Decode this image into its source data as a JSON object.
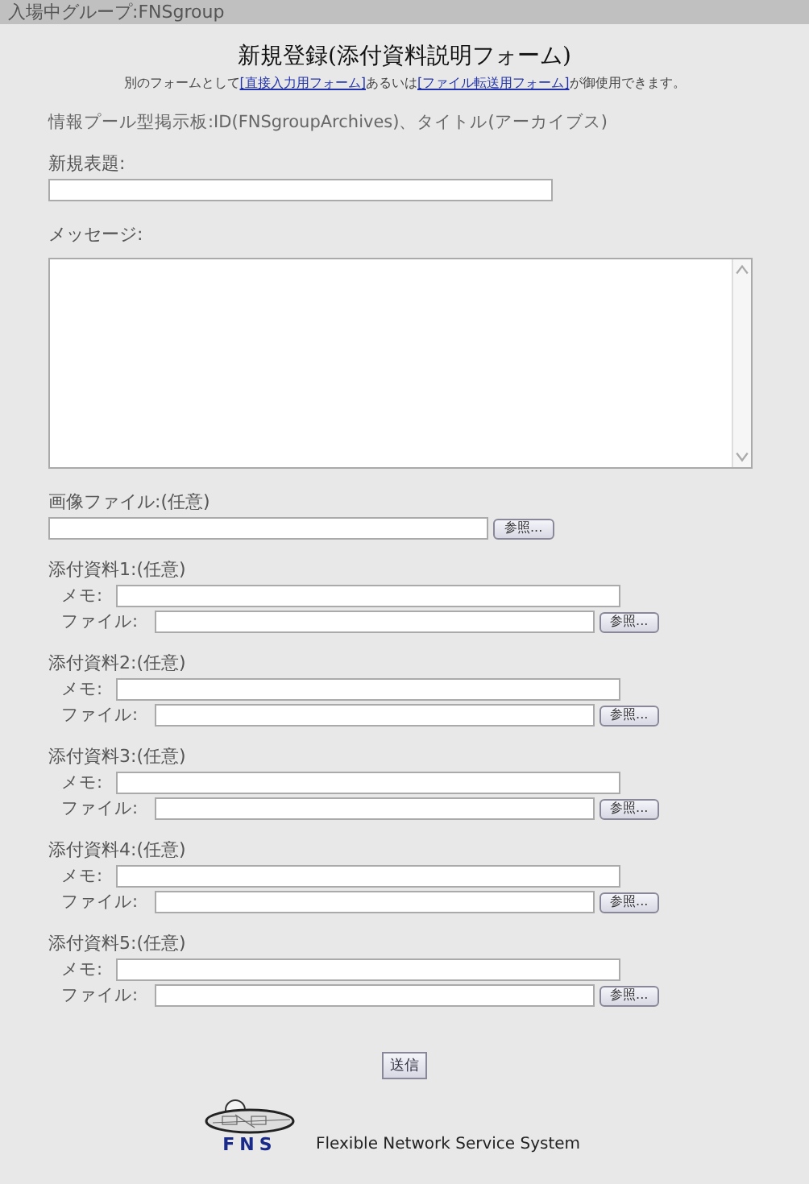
{
  "header": {
    "group_label": "入場中グループ:FNSgroup"
  },
  "title": "新規登録(添付資料説明フォーム)",
  "subtitle": {
    "before": "別のフォームとして",
    "link1": "[直接入力用フォーム]",
    "middle": "あるいは",
    "link2": "[ファイル転送用フォーム]",
    "after": "が御使用できます。"
  },
  "board_info": "情報プール型掲示板:ID(FNSgroupArchives)、タイトル(アーカイブス)",
  "subject_label": "新規表題:",
  "message_label": "メッセージ:",
  "image_label": "画像ファイル:(任意)",
  "browse_label": "参照...",
  "attachments": [
    {
      "label": "添付資料1:(任意)",
      "memo_label": "メモ:",
      "file_label": "ファイル:",
      "browse": "参照..."
    },
    {
      "label": "添付資料2:(任意)",
      "memo_label": "メモ:",
      "file_label": "ファイル:",
      "browse": "参照..."
    },
    {
      "label": "添付資料3:(任意)",
      "memo_label": "メモ:",
      "file_label": "ファイル:",
      "browse": "参照..."
    },
    {
      "label": "添付資料4:(任意)",
      "memo_label": "メモ:",
      "file_label": "ファイル:",
      "browse": "参照..."
    },
    {
      "label": "添付資料5:(任意)",
      "memo_label": "メモ:",
      "file_label": "ファイル:",
      "browse": "参照..."
    }
  ],
  "submit": "送信",
  "footer": {
    "logo_text": "FNS",
    "tagline": "Flexible Network Service System"
  }
}
